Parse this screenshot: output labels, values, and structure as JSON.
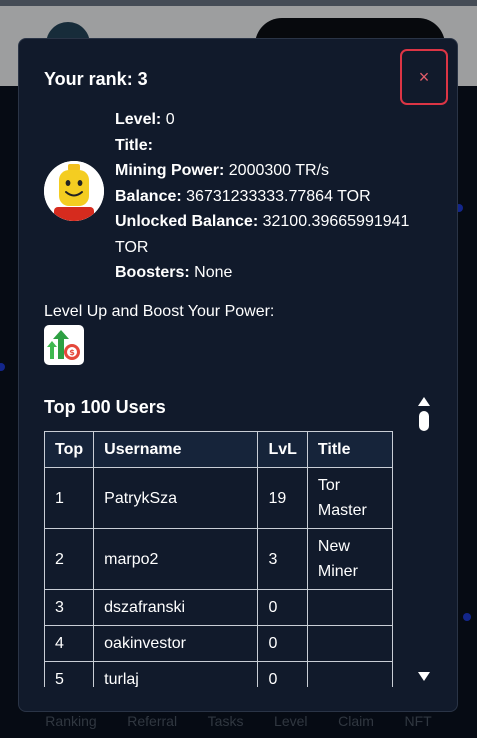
{
  "modal": {
    "title": "Your rank: 3",
    "close_label": "×",
    "stats": {
      "level_label": "Level:",
      "level_value": "0",
      "title_label": "Title:",
      "title_value": "",
      "mining_label": "Mining Power:",
      "mining_value": "2000300 TR/s",
      "balance_label": "Balance:",
      "balance_value": "36731233333.77864 TOR",
      "unlocked_label": "Unlocked Balance:",
      "unlocked_value": "32100.39665991941 TOR",
      "boosters_label": "Boosters:",
      "boosters_value": "None"
    },
    "boost_label": "Level Up and Boost Your Power:",
    "leaderboard_title": "Top 100 Users",
    "columns": [
      "Top",
      "Username",
      "LvL",
      "Title"
    ],
    "rows": [
      {
        "top": "1",
        "username": "PatrykSza",
        "lvl": "19",
        "title": "Tor Master"
      },
      {
        "top": "2",
        "username": "marpo2",
        "lvl": "3",
        "title": "New Miner"
      },
      {
        "top": "3",
        "username": "dszafranski",
        "lvl": "0",
        "title": ""
      },
      {
        "top": "4",
        "username": "oakinvestor",
        "lvl": "0",
        "title": ""
      },
      {
        "top": "5",
        "username": "turlaj",
        "lvl": "0",
        "title": ""
      }
    ]
  },
  "bottom_nav": [
    "Ranking",
    "Referral",
    "Tasks",
    "Level",
    "Claim",
    "NFT"
  ],
  "colors": {
    "modal_bg": "#111a2b",
    "close_border": "#dc3545",
    "accent_green": "#2ea043"
  }
}
